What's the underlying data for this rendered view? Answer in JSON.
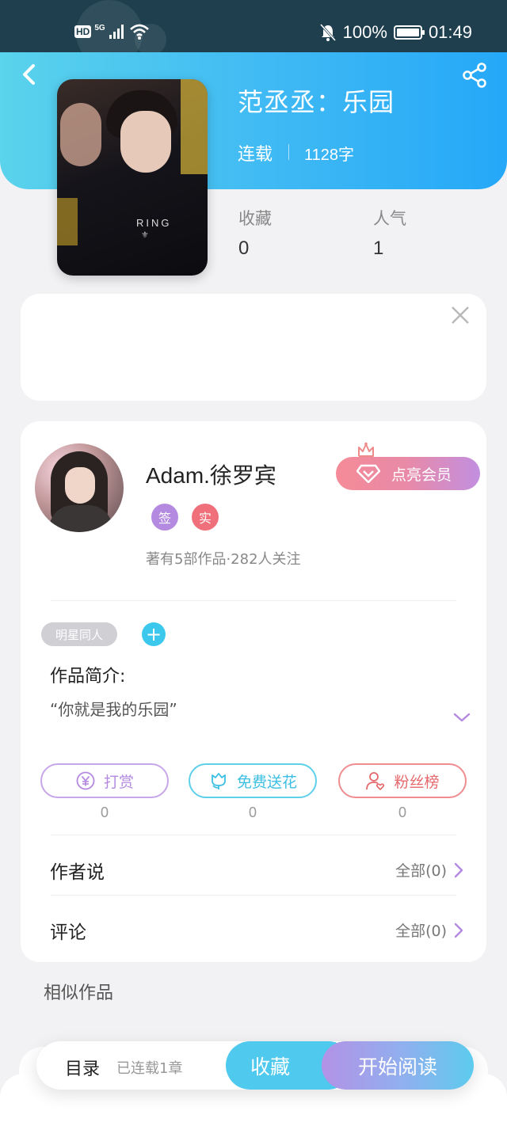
{
  "status_bar": {
    "hd": "HD",
    "network": "5G",
    "battery": "100%",
    "time": "01:49"
  },
  "book": {
    "title": "范丞丞：乐园",
    "serial_status": "连载",
    "word_count": "1128字",
    "collect_label": "收藏",
    "collect_value": "0",
    "popularity_label": "人气",
    "popularity_value": "1",
    "cover_text": "RING"
  },
  "author": {
    "name": "Adam.徐罗宾",
    "badge_sign": "签",
    "badge_real": "实",
    "meta": "著有5部作品·282人关注",
    "vip_label": "点亮会员"
  },
  "details": {
    "tag": "明星同人",
    "add_tag": "+",
    "intro_title": "作品简介:",
    "intro_text": "“你就是我的乐园”"
  },
  "actions": [
    {
      "label": "打赏",
      "count": "0"
    },
    {
      "label": "免费送花",
      "count": "0"
    },
    {
      "label": "粉丝榜",
      "count": "0"
    }
  ],
  "rows": {
    "author_says": {
      "label": "作者说",
      "all": "全部(0)"
    },
    "comments": {
      "label": "评论",
      "all": "全部(0)"
    }
  },
  "similar_title": "相似作品",
  "bottom_bar": {
    "toc": "目录",
    "chapters": "已连载1章",
    "collect": "收藏",
    "read": "开始阅读"
  },
  "colors": {
    "header_gradient_start": "#5ad3ec",
    "header_gradient_end": "#25a8f8",
    "accent_purple": "#b48ae0",
    "accent_cyan": "#3dbfe3",
    "accent_red": "#e4686c"
  },
  "icons": [
    "back-arrow-icon",
    "share-icon",
    "close-icon",
    "gem-icon",
    "crown-icon",
    "chevron-down-icon",
    "yen-coin-icon",
    "flower-icon",
    "user-heart-icon",
    "chevron-right-icon"
  ]
}
